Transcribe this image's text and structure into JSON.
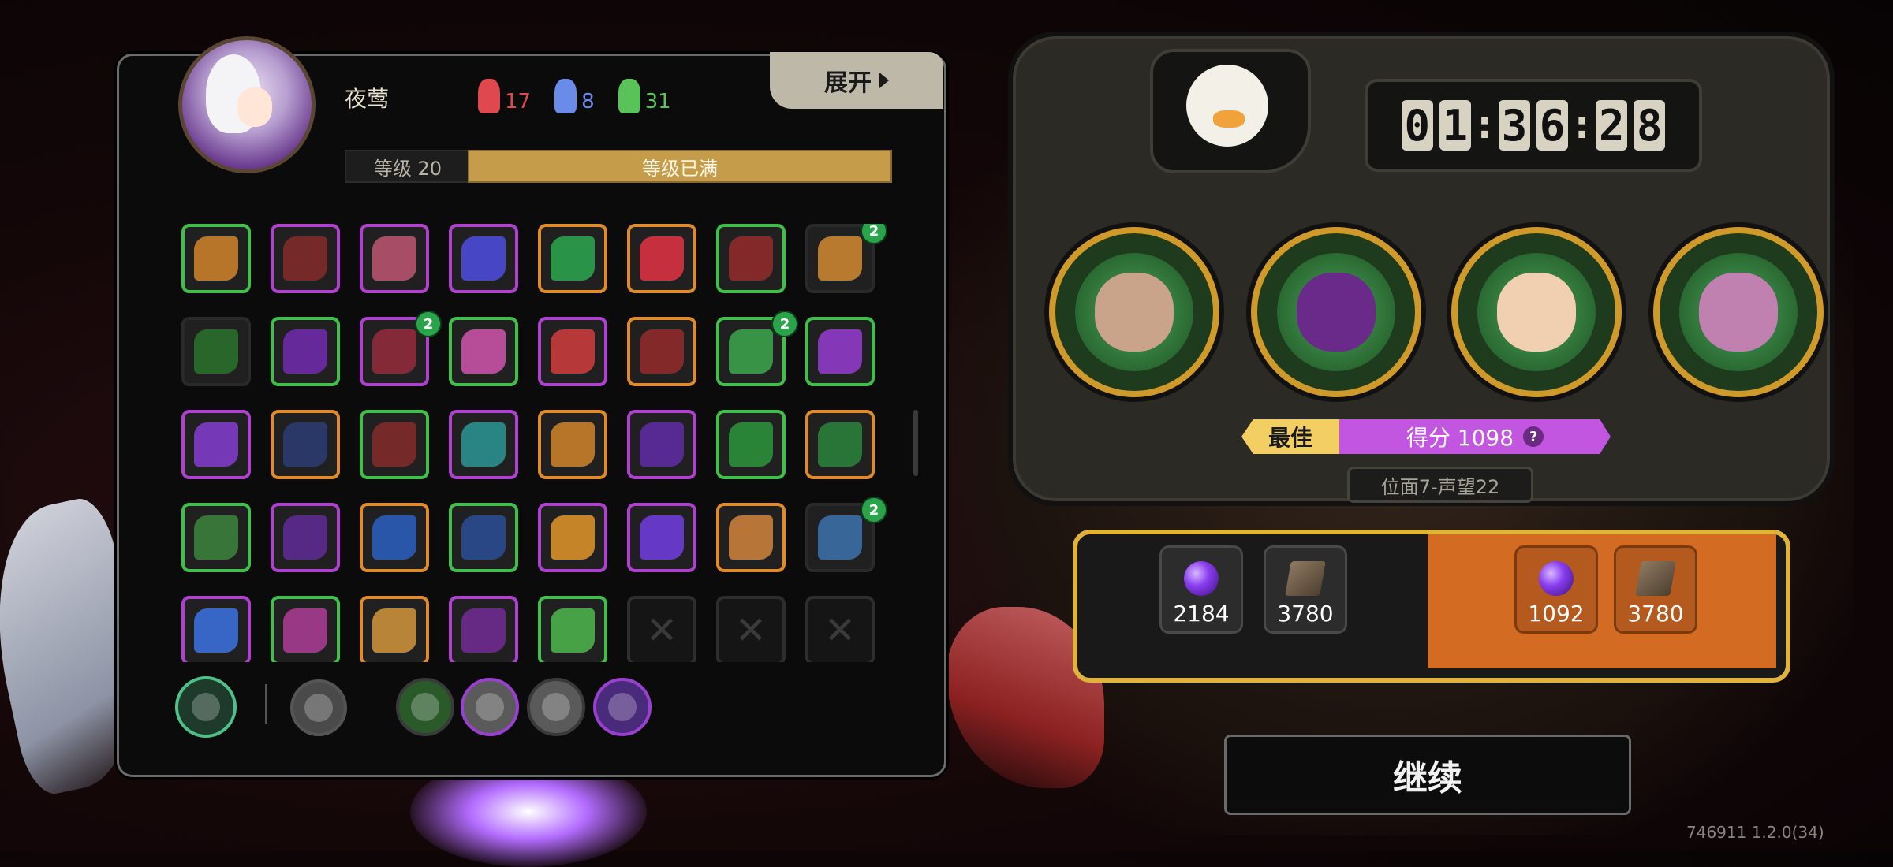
{
  "player": {
    "name": "夜莺",
    "portrait_icon": "silver-haired-gunner-portrait"
  },
  "currencies": [
    {
      "icon": "red-crystal-icon",
      "value": "17",
      "color": "#e0484f"
    },
    {
      "icon": "blue-crystal-icon",
      "value": "8",
      "color": "#6a8ce8"
    },
    {
      "icon": "green-crystal-icon",
      "value": "31",
      "color": "#59c35a"
    }
  ],
  "expand_label": "展开",
  "level": {
    "label": "等级 20",
    "status": "等级已满"
  },
  "skills": [
    {
      "icon": "spike-burst",
      "border": "#3fc04a",
      "bg": "#c07a2a",
      "badge": ""
    },
    {
      "icon": "crossed-guns",
      "border": "#b040d0",
      "bg": "#7a2a2a",
      "badge": ""
    },
    {
      "icon": "fist-pair",
      "border": "#b040d0",
      "bg": "#b0506a",
      "badge": ""
    },
    {
      "icon": "crosshair-star",
      "border": "#b040d0",
      "bg": "#4a4ad0",
      "badge": ""
    },
    {
      "icon": "green-swirl",
      "border": "#e08a2a",
      "bg": "#2a9a4a",
      "badge": ""
    },
    {
      "icon": "crossed-blades",
      "border": "#e08a2a",
      "bg": "#d03040",
      "badge": ""
    },
    {
      "icon": "claw-hand",
      "border": "#3fc04a",
      "bg": "#8a2a2a",
      "badge": ""
    },
    {
      "icon": "lightning-strike",
      "border": "#2a2a2a",
      "bg": "#c08030",
      "badge": "2"
    },
    {
      "icon": "green-v-wings",
      "border": "#2a2a2a",
      "bg": "#2a6a2a",
      "badge": ""
    },
    {
      "icon": "violet-arrows",
      "border": "#3fc04a",
      "bg": "#6a2aa0",
      "badge": ""
    },
    {
      "icon": "stone-pillar",
      "border": "#b040d0",
      "bg": "#8a2a3a",
      "badge": "2"
    },
    {
      "icon": "pink-star-ring",
      "border": "#3fc04a",
      "bg": "#c050a0",
      "badge": ""
    },
    {
      "icon": "red-figure",
      "border": "#b040d0",
      "bg": "#c03a3a",
      "badge": ""
    },
    {
      "icon": "golden-helm",
      "border": "#e08a2a",
      "bg": "#8a2a2a",
      "badge": ""
    },
    {
      "icon": "green-crystals",
      "border": "#3fc04a",
      "bg": "#3a9a4a",
      "badge": "2"
    },
    {
      "icon": "violet-dragon",
      "border": "#3fc04a",
      "bg": "#8a3ac0",
      "badge": ""
    },
    {
      "icon": "lightning-claw",
      "border": "#b040d0",
      "bg": "#7a3ac0",
      "badge": ""
    },
    {
      "icon": "storm-fist",
      "border": "#e08a2a",
      "bg": "#2a3a6a",
      "badge": ""
    },
    {
      "icon": "golden-bullet",
      "border": "#3fc04a",
      "bg": "#7a2a2a",
      "badge": ""
    },
    {
      "icon": "sniper-rifle",
      "border": "#b040d0",
      "bg": "#2a8a8a",
      "badge": ""
    },
    {
      "icon": "rising-sun",
      "border": "#e08a2a",
      "bg": "#c07a2a",
      "badge": ""
    },
    {
      "icon": "violet-spike",
      "border": "#b040d0",
      "bg": "#5a2a9a",
      "badge": ""
    },
    {
      "icon": "red-arrow",
      "border": "#3fc04a",
      "bg": "#2a8a3a",
      "badge": ""
    },
    {
      "icon": "green-fangs",
      "border": "#e08a2a",
      "bg": "#2a7a3a",
      "badge": ""
    },
    {
      "icon": "green-burst",
      "border": "#3fc04a",
      "bg": "#3a7a3a",
      "badge": ""
    },
    {
      "icon": "violet-crown",
      "border": "#b040d0",
      "bg": "#5a2a8a",
      "badge": ""
    },
    {
      "icon": "blue-blade",
      "border": "#e08a2a",
      "bg": "#2a5ab0",
      "badge": ""
    },
    {
      "icon": "blue-explosion",
      "border": "#3fc04a",
      "bg": "#2a4a8a",
      "badge": ""
    },
    {
      "icon": "golden-spiral",
      "border": "#b040d0",
      "bg": "#d08a2a",
      "badge": ""
    },
    {
      "icon": "violet-virus",
      "border": "#b040d0",
      "bg": "#6a3ad0",
      "badge": ""
    },
    {
      "icon": "stone-skull",
      "border": "#e08a2a",
      "bg": "#c07a3a",
      "badge": ""
    },
    {
      "icon": "blue-shark",
      "border": "#2a2a2a",
      "bg": "#3a6aa0",
      "badge": "2"
    },
    {
      "icon": "blue-capsule",
      "border": "#b040d0",
      "bg": "#3a6ad0",
      "badge": ""
    },
    {
      "icon": "pink-feather",
      "border": "#3fc04a",
      "bg": "#a03a8a",
      "badge": ""
    },
    {
      "icon": "golden-gear",
      "border": "#e08a2a",
      "bg": "#c08a3a",
      "badge": ""
    },
    {
      "icon": "violet-beast",
      "border": "#b040d0",
      "bg": "#6a2a8a",
      "badge": ""
    },
    {
      "icon": "green-pillar",
      "border": "#3fc04a",
      "bg": "#4aaa4a",
      "badge": ""
    },
    {
      "icon": "empty-slot",
      "border": "",
      "bg": "",
      "badge": "",
      "empty": true
    },
    {
      "icon": "empty-slot",
      "border": "",
      "bg": "",
      "badge": "",
      "empty": true
    },
    {
      "icon": "empty-slot",
      "border": "",
      "bg": "",
      "badge": "",
      "empty": true
    }
  ],
  "equipment": [
    {
      "icon": "green-burst-ability-icon",
      "ring": "#4fc08a",
      "fill": "#1d3a2a"
    },
    {
      "icon": "pistol-weapon-icon",
      "ring": "#555555",
      "fill": "#4a4a4a"
    },
    {
      "icon": "green-flask-icon",
      "ring": "#3a3a3a",
      "fill": "#2a5a2a"
    },
    {
      "icon": "heart-shield-icon",
      "ring": "#9a40d0",
      "fill": "#5a5a5a"
    },
    {
      "icon": "triangle-core-icon",
      "ring": "#3a3a3a",
      "fill": "#5a5a5a"
    },
    {
      "icon": "violet-spire-icon",
      "ring": "#9a40d0",
      "fill": "#4a2a7a"
    }
  ],
  "timer": {
    "digits": [
      "0",
      "1",
      "3",
      "6",
      "2",
      "8"
    ]
  },
  "mascot_icon": "duck-face-icon",
  "team": [
    {
      "icon": "armored-mask-portrait",
      "char_color": "#c9a48a"
    },
    {
      "icon": "horned-demon-portrait",
      "char_color": "#6a2a8a"
    },
    {
      "icon": "curly-hair-glasses-portrait",
      "char_color": "#f0d0b0"
    },
    {
      "icon": "pink-flower-creature-portrait",
      "char_color": "#c080b0"
    }
  ],
  "best_label": "最佳",
  "score_label": "得分 1098",
  "help_icon": "?",
  "stage_label": "位面7-声望22",
  "rewards": [
    {
      "icon": "purple-orb-icon",
      "value": "2184",
      "boost": false
    },
    {
      "icon": "skill-book-icon",
      "value": "3780",
      "boost": false
    },
    {
      "icon": "purple-orb-boost-icon",
      "value": "1092",
      "boost": true
    },
    {
      "icon": "skill-book-boost-icon",
      "value": "3780",
      "boost": true
    }
  ],
  "continue_label": "继续",
  "version": "746911 1.2.0(34)"
}
